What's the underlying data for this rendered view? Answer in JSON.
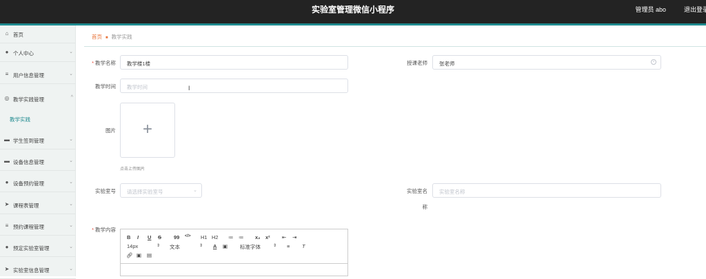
{
  "header": {
    "title": "实验室管理微信小程序",
    "admin": "管理员 abo",
    "logout": "退出登录"
  },
  "sidebar": {
    "items": [
      {
        "label": "首页",
        "icon": "home-icon",
        "chevron": ""
      },
      {
        "label": "个人中心",
        "icon": "user-icon",
        "chevron": "⌄"
      },
      {
        "label": "用户信息管理",
        "icon": "list-icon",
        "chevron": "⌄"
      },
      {
        "label": "教学实践管理",
        "icon": "circle-icon",
        "chevron": "^"
      },
      {
        "label": "学生签到管理",
        "icon": "card-icon",
        "chevron": "⌄"
      },
      {
        "label": "设备信息管理",
        "icon": "card-icon",
        "chevron": "⌄"
      },
      {
        "label": "设备预约管理",
        "icon": "user-icon",
        "chevron": "⌄"
      },
      {
        "label": "课程表管理",
        "icon": "send-icon",
        "chevron": "⌄"
      },
      {
        "label": "预约课程管理",
        "icon": "list-icon",
        "chevron": "⌄"
      },
      {
        "label": "预定实验室管理",
        "icon": "user-icon",
        "chevron": "⌄"
      },
      {
        "label": "实验室信息管理",
        "icon": "send-icon",
        "chevron": "⌄"
      }
    ],
    "sub_active": "教学实践"
  },
  "breadcrumb": {
    "home": "首页",
    "current": "教学实践"
  },
  "form": {
    "name_label": "教学名称",
    "name_value": "教学楼1楼",
    "teacher_label": "授课老师",
    "teacher_value": "张老师",
    "time_label": "教学时间",
    "time_placeholder": "教学时间",
    "image_label": "图片",
    "upload_tip": "点击上传图片",
    "lab_no_label": "实验室号",
    "lab_no_placeholder": "请选择实验室号",
    "lab_name_label_1": "实验室名",
    "lab_name_label_2": "称",
    "lab_name_placeholder": "实验室名称",
    "content_label": "教学内容"
  },
  "editor": {
    "row1": [
      "B",
      "I",
      "U",
      "S",
      "99",
      "</>",
      "H1",
      "H2",
      "≔",
      "≔",
      "x₂",
      "x²",
      "⇤",
      "⇥"
    ],
    "font_size": "14px",
    "text_style": "文本",
    "font_family": "标准字体"
  }
}
